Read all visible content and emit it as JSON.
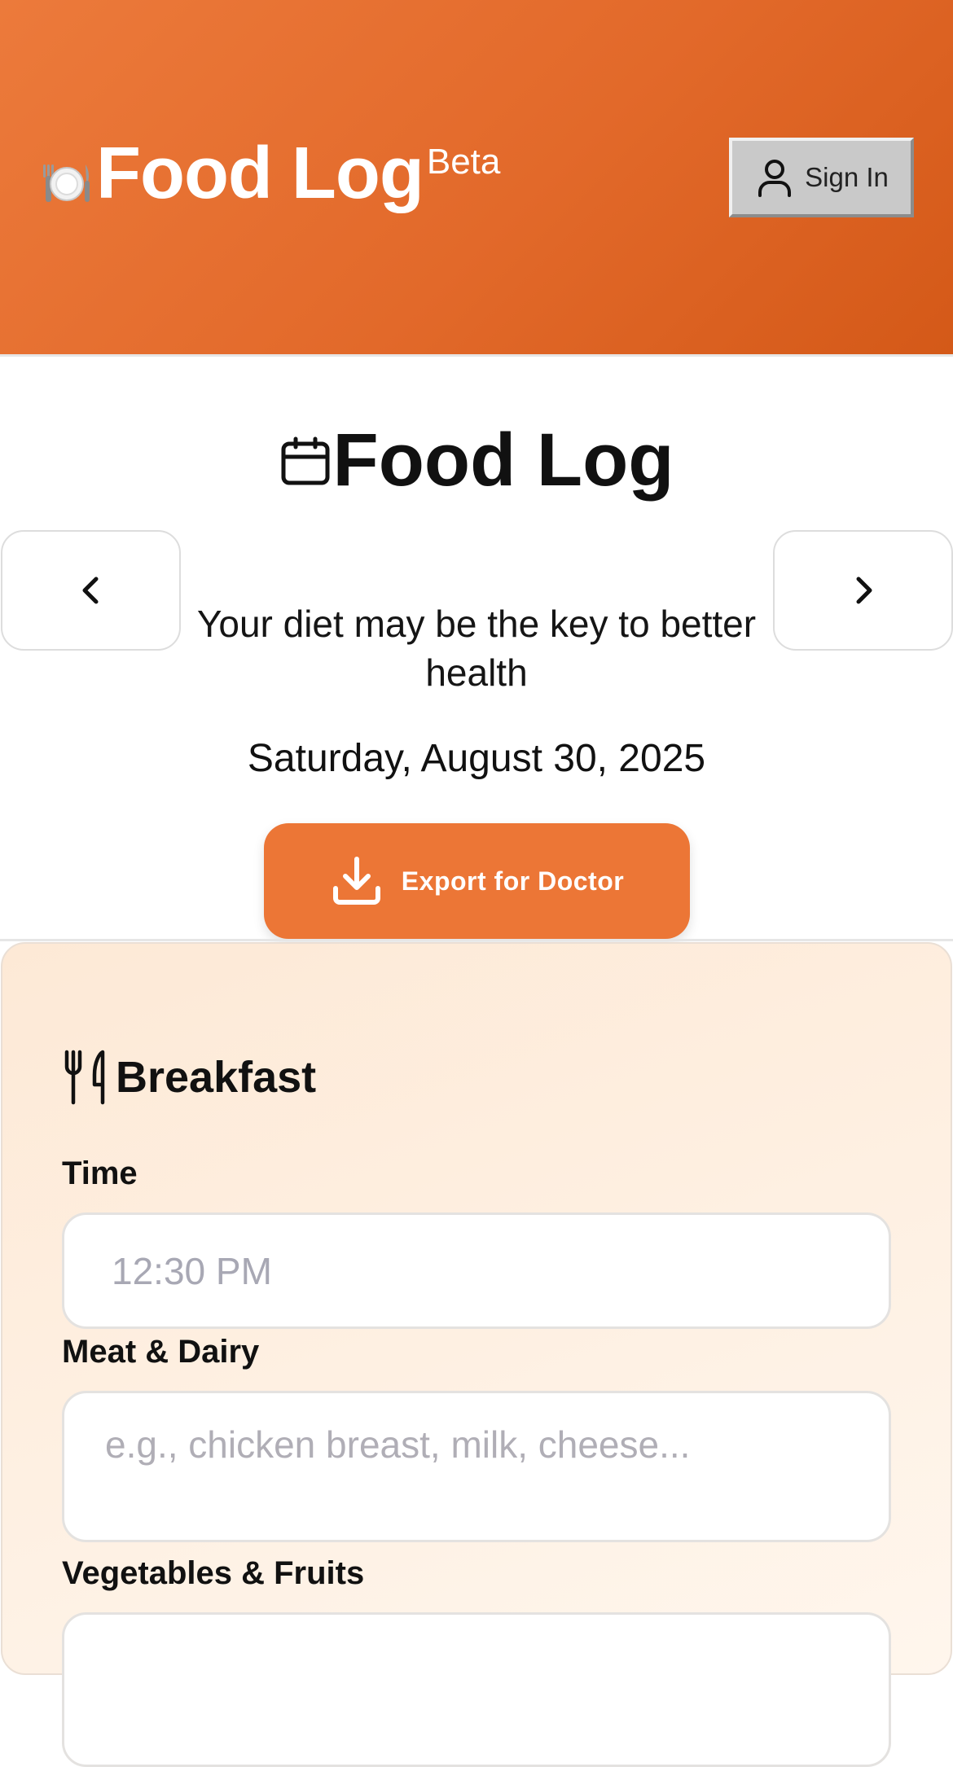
{
  "header": {
    "brand_title": "Food Log",
    "brand_badge": "Beta",
    "brand_icon": "plate-with-cutlery-icon",
    "signin_label": "Sign In",
    "signin_icon": "user-icon"
  },
  "main": {
    "title": "Food Log",
    "title_icon": "calendar-icon",
    "tagline": "Your diet may be the key to better health",
    "date": "Saturday, August 30, 2025",
    "export_label": "Export for Doctor",
    "export_icon": "download-icon",
    "prev_icon": "chevron-left-icon",
    "next_icon": "chevron-right-icon"
  },
  "meal": {
    "title": "Breakfast",
    "icon": "utensils-icon",
    "fields": {
      "time": {
        "label": "Time",
        "value": "12:30 PM"
      },
      "meat": {
        "label": "Meat & Dairy",
        "placeholder": "e.g., chicken breast, milk, cheese..."
      },
      "veg": {
        "label": "Vegetables & Fruits"
      }
    }
  },
  "colors": {
    "brand_orange": "#E87434",
    "export_button": "#EC7636",
    "card_background": "#FDEBDA"
  }
}
